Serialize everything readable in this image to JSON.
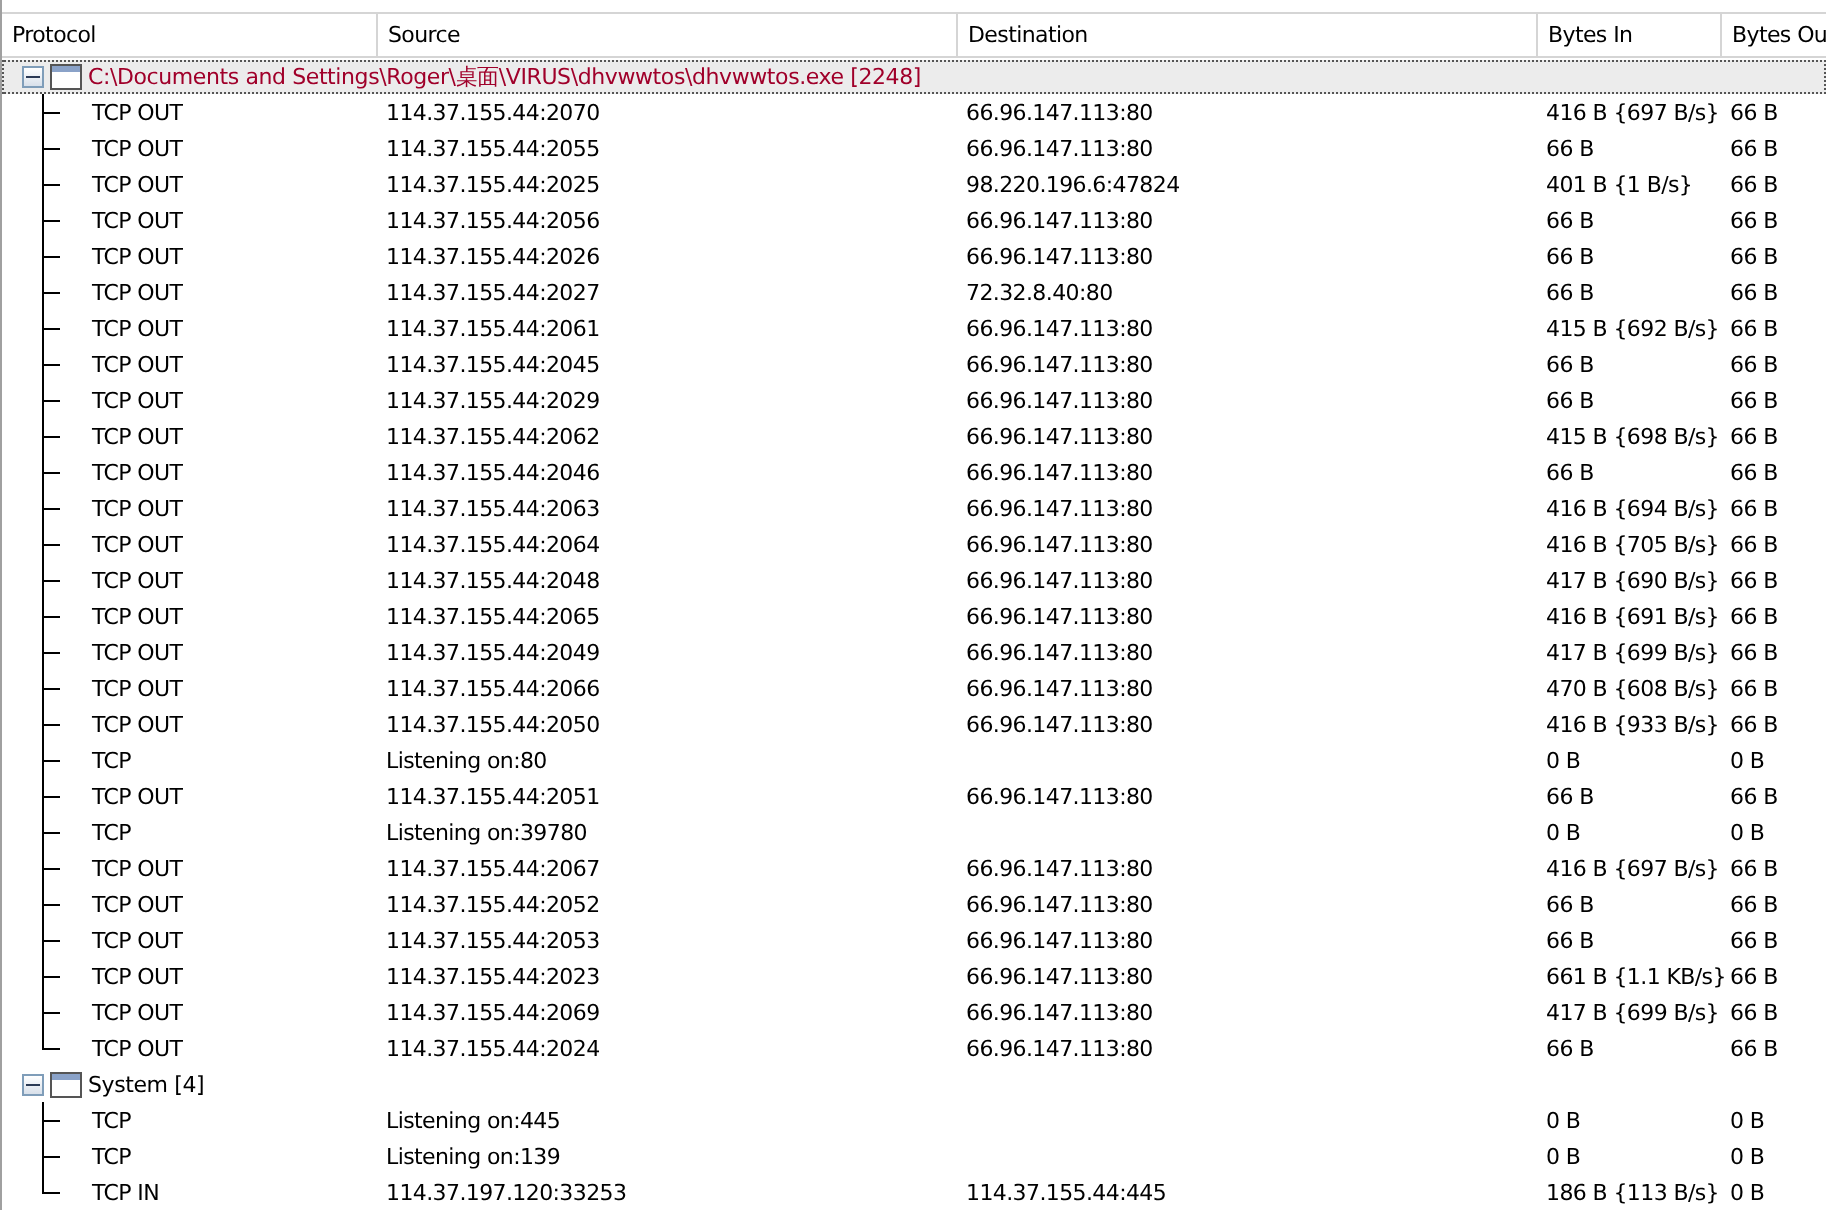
{
  "columns": [
    "Protocol",
    "Source",
    "Destination",
    "Bytes In",
    "Bytes Ou"
  ],
  "groups": [
    {
      "label": "C:\\Documents and Settings\\Roger\\桌面\\VIRUS\\dhvwwtos\\dhvwwtos.exe [2248]",
      "color": "#a0002a",
      "expanded": true,
      "selected": true,
      "rows": [
        {
          "protocol": "TCP OUT",
          "source": "114.37.155.44:2070",
          "destination": "66.96.147.113:80",
          "bytes_in": "416 B {697 B/s}",
          "bytes_out": "66 B"
        },
        {
          "protocol": "TCP OUT",
          "source": "114.37.155.44:2055",
          "destination": "66.96.147.113:80",
          "bytes_in": "66 B",
          "bytes_out": "66 B"
        },
        {
          "protocol": "TCP OUT",
          "source": "114.37.155.44:2025",
          "destination": "98.220.196.6:47824",
          "bytes_in": "401 B {1 B/s}",
          "bytes_out": "66 B"
        },
        {
          "protocol": "TCP OUT",
          "source": "114.37.155.44:2056",
          "destination": "66.96.147.113:80",
          "bytes_in": "66 B",
          "bytes_out": "66 B"
        },
        {
          "protocol": "TCP OUT",
          "source": "114.37.155.44:2026",
          "destination": "66.96.147.113:80",
          "bytes_in": "66 B",
          "bytes_out": "66 B"
        },
        {
          "protocol": "TCP OUT",
          "source": "114.37.155.44:2027",
          "destination": "72.32.8.40:80",
          "bytes_in": "66 B",
          "bytes_out": "66 B"
        },
        {
          "protocol": "TCP OUT",
          "source": "114.37.155.44:2061",
          "destination": "66.96.147.113:80",
          "bytes_in": "415 B {692 B/s}",
          "bytes_out": "66 B"
        },
        {
          "protocol": "TCP OUT",
          "source": "114.37.155.44:2045",
          "destination": "66.96.147.113:80",
          "bytes_in": "66 B",
          "bytes_out": "66 B"
        },
        {
          "protocol": "TCP OUT",
          "source": "114.37.155.44:2029",
          "destination": "66.96.147.113:80",
          "bytes_in": "66 B",
          "bytes_out": "66 B"
        },
        {
          "protocol": "TCP OUT",
          "source": "114.37.155.44:2062",
          "destination": "66.96.147.113:80",
          "bytes_in": "415 B {698 B/s}",
          "bytes_out": "66 B"
        },
        {
          "protocol": "TCP OUT",
          "source": "114.37.155.44:2046",
          "destination": "66.96.147.113:80",
          "bytes_in": "66 B",
          "bytes_out": "66 B"
        },
        {
          "protocol": "TCP OUT",
          "source": "114.37.155.44:2063",
          "destination": "66.96.147.113:80",
          "bytes_in": "416 B {694 B/s}",
          "bytes_out": "66 B"
        },
        {
          "protocol": "TCP OUT",
          "source": "114.37.155.44:2064",
          "destination": "66.96.147.113:80",
          "bytes_in": "416 B {705 B/s}",
          "bytes_out": "66 B"
        },
        {
          "protocol": "TCP OUT",
          "source": "114.37.155.44:2048",
          "destination": "66.96.147.113:80",
          "bytes_in": "417 B {690 B/s}",
          "bytes_out": "66 B"
        },
        {
          "protocol": "TCP OUT",
          "source": "114.37.155.44:2065",
          "destination": "66.96.147.113:80",
          "bytes_in": "416 B {691 B/s}",
          "bytes_out": "66 B"
        },
        {
          "protocol": "TCP OUT",
          "source": "114.37.155.44:2049",
          "destination": "66.96.147.113:80",
          "bytes_in": "417 B {699 B/s}",
          "bytes_out": "66 B"
        },
        {
          "protocol": "TCP OUT",
          "source": "114.37.155.44:2066",
          "destination": "66.96.147.113:80",
          "bytes_in": "470 B {608 B/s}",
          "bytes_out": "66 B"
        },
        {
          "protocol": "TCP OUT",
          "source": "114.37.155.44:2050",
          "destination": "66.96.147.113:80",
          "bytes_in": "416 B {933 B/s}",
          "bytes_out": "66 B"
        },
        {
          "protocol": "TCP",
          "source": "Listening on:80",
          "bytes_in": "0 B",
          "bytes_out": "0 B"
        },
        {
          "protocol": "TCP OUT",
          "source": "114.37.155.44:2051",
          "destination": "66.96.147.113:80",
          "bytes_in": "66 B",
          "bytes_out": "66 B"
        },
        {
          "protocol": "TCP",
          "source": "Listening on:39780",
          "bytes_in": "0 B",
          "bytes_out": "0 B"
        },
        {
          "protocol": "TCP OUT",
          "source": "114.37.155.44:2067",
          "destination": "66.96.147.113:80",
          "bytes_in": "416 B {697 B/s}",
          "bytes_out": "66 B"
        },
        {
          "protocol": "TCP OUT",
          "source": "114.37.155.44:2052",
          "destination": "66.96.147.113:80",
          "bytes_in": "66 B",
          "bytes_out": "66 B"
        },
        {
          "protocol": "TCP OUT",
          "source": "114.37.155.44:2053",
          "destination": "66.96.147.113:80",
          "bytes_in": "66 B",
          "bytes_out": "66 B"
        },
        {
          "protocol": "TCP OUT",
          "source": "114.37.155.44:2023",
          "destination": "66.96.147.113:80",
          "bytes_in": "661 B {1.1 KB/s}",
          "bytes_out": "66 B"
        },
        {
          "protocol": "TCP OUT",
          "source": "114.37.155.44:2069",
          "destination": "66.96.147.113:80",
          "bytes_in": "417 B {699 B/s}",
          "bytes_out": "66 B"
        },
        {
          "protocol": "TCP OUT",
          "source": "114.37.155.44:2024",
          "destination": "66.96.147.113:80",
          "bytes_in": "66 B",
          "bytes_out": "66 B"
        }
      ]
    },
    {
      "label": "System [4]",
      "color": "#000000",
      "expanded": true,
      "selected": false,
      "rows": [
        {
          "protocol": "TCP",
          "source": "Listening on:445",
          "bytes_in": "0 B",
          "bytes_out": "0 B"
        },
        {
          "protocol": "TCP",
          "source": "Listening on:139",
          "bytes_in": "0 B",
          "bytes_out": "0 B"
        },
        {
          "protocol": "TCP IN",
          "source": "114.37.197.120:33253",
          "destination": "114.37.155.44:445",
          "bytes_in": "186 B {113 B/s}",
          "bytes_out": "0 B"
        }
      ]
    }
  ]
}
